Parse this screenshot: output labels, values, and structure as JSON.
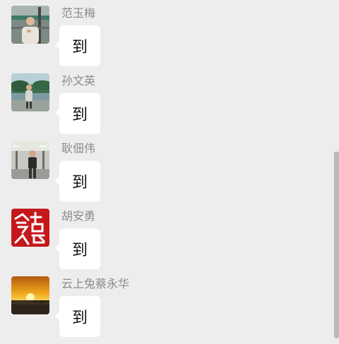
{
  "messages": [
    {
      "sender": "范玉梅",
      "text": "到",
      "avatar": "photo-man-railing"
    },
    {
      "sender": "孙文英",
      "text": "到",
      "avatar": "photo-woman-lake"
    },
    {
      "sender": "耿佃伟",
      "text": "到",
      "avatar": "photo-man-station"
    },
    {
      "sender": "胡安勇",
      "text": "到",
      "avatar": "red-calligraphy-seal"
    },
    {
      "sender": "云上兔蔡永华",
      "text": "到",
      "avatar": "photo-sunset"
    }
  ],
  "colors": {
    "background": "#ededed",
    "bubble": "#ffffff",
    "sender_name": "#8a8a8a",
    "seal_red": "#c4181b"
  }
}
